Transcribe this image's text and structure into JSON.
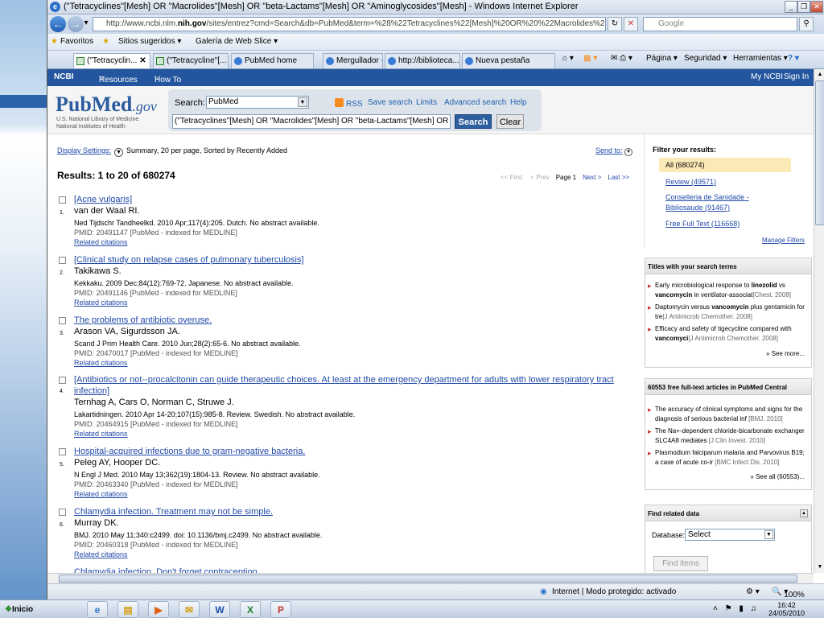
{
  "window": {
    "title": "(\"Tetracyclines\"[Mesh] OR \"Macrolides\"[Mesh] OR \"beta-Lactams\"[Mesh] OR \"Aminoglycosides\"[Mesh] - Windows Internet Explorer",
    "url_prefix": "http://www.ncbi.nlm.",
    "url_domain": "nih.gov",
    "url_rest": "/sites/entrez?cmd=Search&db=PubMed&term=%28%22Tetracyclines%22[Mesh]%20OR%20%22Macrolides%22[Mesh]%2(",
    "search_engine": "Google"
  },
  "favorites": {
    "favoritos": "Favoritos",
    "suggested": "Sitios sugeridos ▾",
    "gallery": "Galería de Web Slice ▾"
  },
  "tabs": [
    {
      "label": "(\"Tetracyclin...",
      "active": true,
      "close": "✕"
    },
    {
      "label": "(\"Tetracycline\"[...",
      "active": false
    },
    {
      "label": "PubMed home",
      "active": false
    },
    {
      "label": "Mergullador - In...",
      "active": false
    },
    {
      "label": "http://biblioteca...",
      "active": false
    },
    {
      "label": "Nueva pestaña",
      "active": false
    }
  ],
  "commandbar": {
    "page": "Página ▾",
    "security": "Seguridad ▾",
    "tools": "Herramientas ▾",
    "help": "? ▾"
  },
  "ncbi_bar": {
    "logo": "NCBI",
    "resources": "Resources",
    "howto": "How To",
    "myncbi": "My NCBI",
    "signin": "Sign In"
  },
  "header": {
    "logo_pub": "Pub",
    "logo_med": "Med",
    "logo_gov": ".gov",
    "logo_sub1": "U.S. National Library of Medicine",
    "logo_sub2": "National Institutes of Health",
    "search_label": "Search:",
    "database": "PubMed",
    "rss": "RSS",
    "save_search": "Save search",
    "limits": "Limits",
    "advanced": "Advanced search",
    "help": "Help",
    "term": "(\"Tetracyclines\"[Mesh] OR \"Macrolides\"[Mesh] OR \"beta-Lactams\"[Mesh] OR",
    "search_button": "Search",
    "clear_button": "Clear"
  },
  "main": {
    "display_settings": "Display Settings:",
    "display_value": "Summary, 20 per page, Sorted by Recently Added",
    "send_to": "Send to:",
    "results": "Results: 1 to 20 of 680274",
    "first": "<< First",
    "prev": "< Prev",
    "page": "Page 1",
    "next": "Next >",
    "last": "Last >>",
    "items": [
      {
        "num": "1.",
        "title": "[Acne vulgaris]",
        "authors": "van der Waal RI.",
        "source": "Ned Tijdschr Tandheelkd. 2010 Apr;117(4):205. Dutch. No abstract available.",
        "pmid": "PMID: 20491147 [PubMed - indexed for MEDLINE]",
        "related": "Related citations"
      },
      {
        "num": "2.",
        "title": "[Clinical study on relapse cases of pulmonary tuberculosis]",
        "authors": "Takikawa S.",
        "source": "Kekkaku. 2009 Dec;84(12):769-72. Japanese. No abstract available.",
        "pmid": "PMID: 20491146 [PubMed - indexed for MEDLINE]",
        "related": "Related citations"
      },
      {
        "num": "3.",
        "title": "The problems of antibiotic overuse.",
        "authors": "Arason VA, Sigurdsson JA.",
        "source": "Scand J Prim Health Care. 2010 Jun;28(2):65-6. No abstract available.",
        "pmid": "PMID: 20470017 [PubMed - indexed for MEDLINE]",
        "related": "Related citations"
      },
      {
        "num": "4.",
        "title": "[Antibiotics or not--procalcitonin can guide therapeutic choices. At least at the emergency department for adults with lower respiratory tract infection]",
        "authors": "Ternhag A, Cars O, Norman C, Struwe J.",
        "source": "Lakartidningen. 2010 Apr 14-20;107(15):985-8. Review. Swedish. No abstract available.",
        "pmid": "PMID: 20464915 [PubMed - indexed for MEDLINE]",
        "related": "Related citations"
      },
      {
        "num": "5.",
        "title": "Hospital-acquired infections due to gram-negative bacteria.",
        "authors": "Peleg AY, Hooper DC.",
        "source": "N Engl J Med. 2010 May 13;362(19):1804-13. Review. No abstract available.",
        "pmid": "PMID: 20463340 [PubMed - indexed for MEDLINE]",
        "related": "Related citations"
      },
      {
        "num": "6.",
        "title": "Chlamydia infection. Treatment may not be simple.",
        "authors": "Murray DK.",
        "source": "BMJ. 2010 May 11;340:c2499. doi: 10.1136/bmj.c2499. No abstract available.",
        "pmid": "PMID: 20460318 [PubMed - indexed for MEDLINE]",
        "related": "Related citations"
      },
      {
        "num": "",
        "title": "Chlamydia infection. Don't forget contraception",
        "authors": "",
        "source": "",
        "pmid": "",
        "related": ""
      }
    ]
  },
  "sidebar": {
    "filter_title": "Filter your results:",
    "filter_all": "All (680274)",
    "filter_review": "Review (49571)",
    "filter_conselleria": "Conselleria de Sanidade - Bibliosaude (91467)",
    "filter_free": "Free Full Text (116668)",
    "manage": "Manage Filters",
    "titles_header": "Titles with your search terms",
    "titles": [
      {
        "pre": "Early microbiological response to ",
        "b1": "linezolid",
        "mid": " vs ",
        "b2": "vancomycin",
        "post": " in ventilator-associat",
        "journal": "[Chest. 2008]"
      },
      {
        "pre": "Daptomycin versus ",
        "b1": "vancomycin",
        "mid": " plus gentamicin for tre",
        "b2": "",
        "post": "",
        "journal": "[J Antimicrob Chemother. 2008]"
      },
      {
        "pre": "Efficacy and safety of tigecycline compared with ",
        "b1": "vancomyci",
        "mid": "",
        "b2": "",
        "post": "",
        "journal": "[J Antimicrob Chemother. 2008]"
      }
    ],
    "see_more": "» See more...",
    "pmc_header": "60553 free full-text articles in PubMed Central",
    "pmc": [
      {
        "text": "The accuracy of clinical symptoms and signs for the diagnosis of serious bacterial inf",
        "journal": "[BMJ. 2010]"
      },
      {
        "text": "The Na+-dependent chloride-bicarbonate exchanger SLC4A8 mediates",
        "journal": "[J Clin Invest. 2010]"
      },
      {
        "text": "Plasmodium falciparum malaria and Parvovirus B19; a case of acute co-ir",
        "journal": "[BMC Infect Dis. 2010]"
      }
    ],
    "see_all": "» See all (60553)...",
    "related_header": "Find related data",
    "database_label": "Database:",
    "database_value": "Select",
    "find_items": "Find items"
  },
  "status": {
    "zone": "Internet | Modo protegido: activado",
    "zoom": "100%"
  },
  "taskbar": {
    "start": "Inicio",
    "time": "16:42",
    "date": "24/05/2010"
  },
  "colors": {
    "ncbi_bar": "#23569e",
    "link": "#2149a8",
    "filter_highlight": "#fbe9b7"
  }
}
